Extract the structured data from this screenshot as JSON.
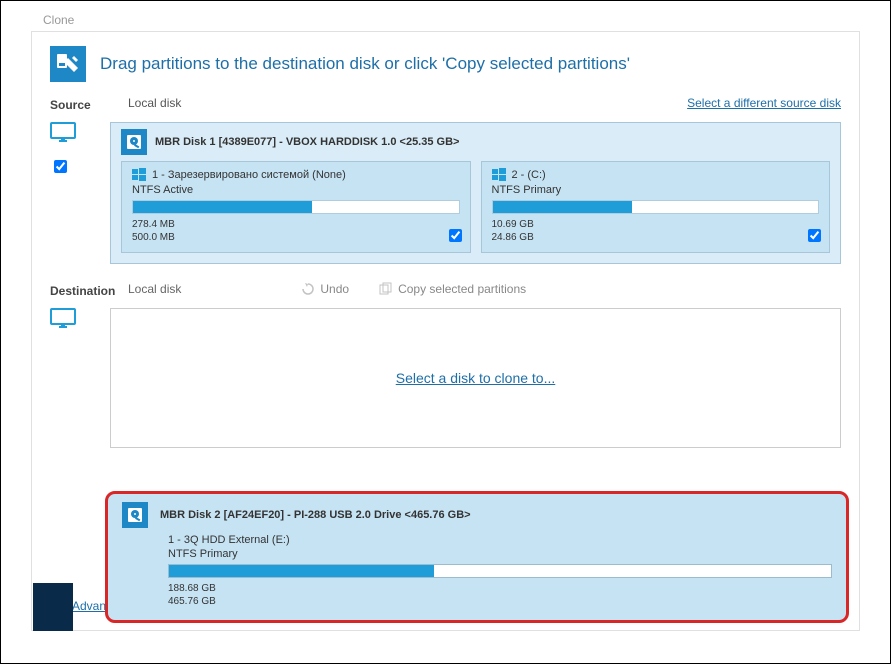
{
  "window_label": "Clone",
  "header": {
    "title": "Drag partitions to the destination disk or click 'Copy selected partitions'"
  },
  "source": {
    "label": "Source",
    "location": "Local disk",
    "select_link": "Select a different source disk",
    "disk": {
      "title": "MBR Disk 1 [4389E077] - VBOX HARDDISK 1.0  <25.35 GB>",
      "partitions": [
        {
          "name": "1 - Зарезервировано системой (None)",
          "type": "NTFS Active",
          "used": "278.4 MB",
          "total": "500.0 MB",
          "fill_pct": 55,
          "checked": true
        },
        {
          "name": "2 -  (C:)",
          "type": "NTFS Primary",
          "used": "10.69 GB",
          "total": "24.86 GB",
          "fill_pct": 43,
          "checked": true
        }
      ]
    }
  },
  "destination": {
    "label": "Destination",
    "location": "Local disk",
    "undo_label": "Undo",
    "copy_label": "Copy selected partitions",
    "placeholder_link": "Select a disk to clone to..."
  },
  "advanced_link": "Advan",
  "popup_disk": {
    "title": "MBR Disk 2 [AF24EF20] - PI-288    USB 2.0 Drive  <465.76 GB>",
    "partition": {
      "name": "1 - 3Q HDD External (E:)",
      "type": "NTFS Primary",
      "used": "188.68 GB",
      "total": "465.76 GB",
      "fill_pct": 40
    }
  }
}
